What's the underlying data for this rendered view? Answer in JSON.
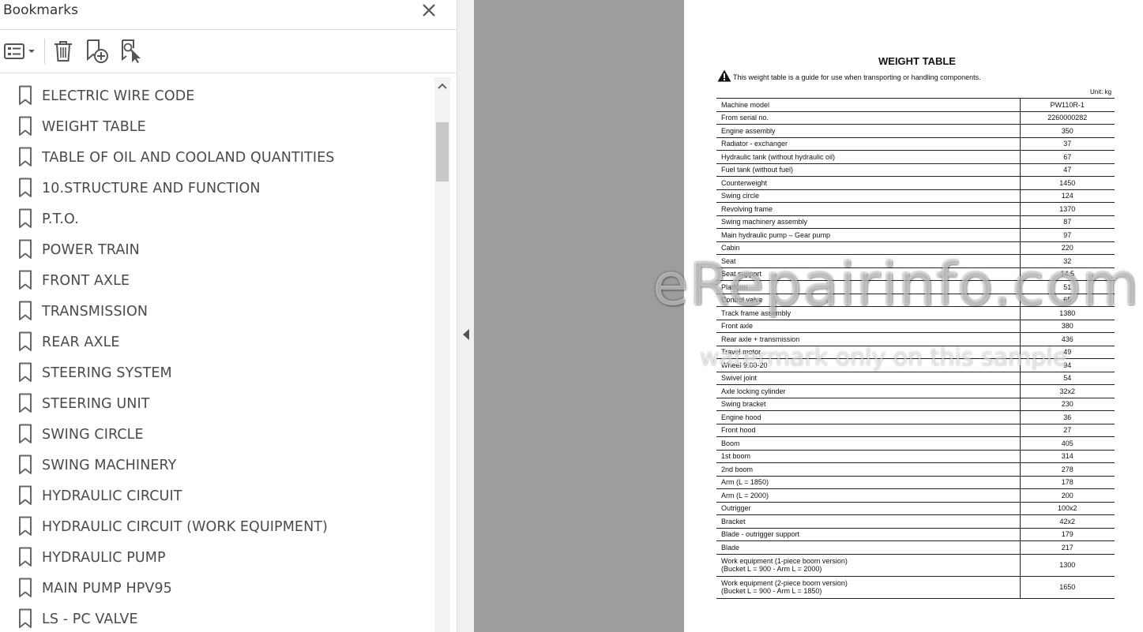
{
  "panel": {
    "title": "Bookmarks",
    "toolbar": {
      "options_icon": "list-options-icon",
      "delete_icon": "trash-icon",
      "new_bookmark_icon": "new-bookmark-icon",
      "find_bookmark_icon": "find-bookmark-icon"
    },
    "items": [
      {
        "label": "ELECTRIC WIRE CODE"
      },
      {
        "label": "WEIGHT TABLE"
      },
      {
        "label": "TABLE OF OIL AND COOLAND QUANTITIES"
      },
      {
        "label": "10.STRUCTURE AND FUNCTION"
      },
      {
        "label": "P.T.O."
      },
      {
        "label": "POWER TRAIN"
      },
      {
        "label": "FRONT AXLE"
      },
      {
        "label": "TRANSMISSION"
      },
      {
        "label": "REAR AXLE"
      },
      {
        "label": "STEERING SYSTEM"
      },
      {
        "label": "STEERING UNIT"
      },
      {
        "label": "SWING CIRCLE"
      },
      {
        "label": "SWING MACHINERY"
      },
      {
        "label": "HYDRAULIC CIRCUIT"
      },
      {
        "label": "HYDRAULIC CIRCUIT (WORK EQUIPMENT)"
      },
      {
        "label": "HYDRAULIC PUMP"
      },
      {
        "label": "MAIN PUMP HPV95"
      },
      {
        "label": "LS - PC VALVE"
      }
    ]
  },
  "document": {
    "title": "WEIGHT TABLE",
    "warning": "This weight table is a guide for use when transporting or handling components.",
    "unit": "Unit: kg",
    "rows": [
      {
        "name": "Machine model",
        "value": "PW110R-1"
      },
      {
        "name": "From serial no.",
        "value": "2260000282"
      },
      {
        "name": "Engine assembly",
        "value": "350"
      },
      {
        "name": "Radiator - exchanger",
        "value": "37"
      },
      {
        "name": "Hydraulic tank (without hydraulic oil)",
        "value": "67"
      },
      {
        "name": "Fuel tank (without fuel)",
        "value": "47"
      },
      {
        "name": "Counterweight",
        "value": "1450"
      },
      {
        "name": "Swing circle",
        "value": "124"
      },
      {
        "name": "Revolving frame",
        "value": "1370"
      },
      {
        "name": "Swing machinery assembly",
        "value": "87"
      },
      {
        "name": "Main hydraulic pump – Gear pump",
        "value": "97"
      },
      {
        "name": "Cabin",
        "value": "220"
      },
      {
        "name": "Seat",
        "value": "32"
      },
      {
        "name": "Seat support",
        "value": "14.5"
      },
      {
        "name": "Platform",
        "value": "51"
      },
      {
        "name": "Control valve",
        "value": "65"
      },
      {
        "name": "Track frame assembly",
        "value": "1380"
      },
      {
        "name": "Front axle",
        "value": "380"
      },
      {
        "name": "Rear axle + transmission",
        "value": "436"
      },
      {
        "name": "Travel motor",
        "value": "49"
      },
      {
        "name": "Wheel 9.00-20",
        "value": "94"
      },
      {
        "name": "Swivel joint",
        "value": "54"
      },
      {
        "name": "Axle locking cylinder",
        "value": "32x2"
      },
      {
        "name": "Swing bracket",
        "value": "230"
      },
      {
        "name": "Engine hood",
        "value": "36"
      },
      {
        "name": "Front hood",
        "value": "27"
      },
      {
        "name": "Boom",
        "value": "405"
      },
      {
        "name": "1st boom",
        "value": "314"
      },
      {
        "name": "2nd boom",
        "value": "278"
      },
      {
        "name": "Arm (L = 1850)",
        "value": "178"
      },
      {
        "name": "Arm (L = 2000)",
        "value": "200"
      },
      {
        "name": "Outrigger",
        "value": "100x2"
      },
      {
        "name": "Bracket",
        "value": "42x2"
      },
      {
        "name": "Blade - outrigger support",
        "value": "179"
      },
      {
        "name": "Blade",
        "value": "217"
      }
    ],
    "tall_rows": [
      {
        "line1": "Work equipment (1-piece boom version)",
        "line2": "(Bucket L = 900 - Arm L = 2000)",
        "value": "1300"
      },
      {
        "line1": "Work equipment (2-piece boom version)",
        "line2": "(Bucket L = 900  - Arm L = 1850)",
        "value": "1650"
      }
    ]
  },
  "watermark": {
    "main": "eRepairinfo.com",
    "sub": "watermark only on this sample"
  }
}
